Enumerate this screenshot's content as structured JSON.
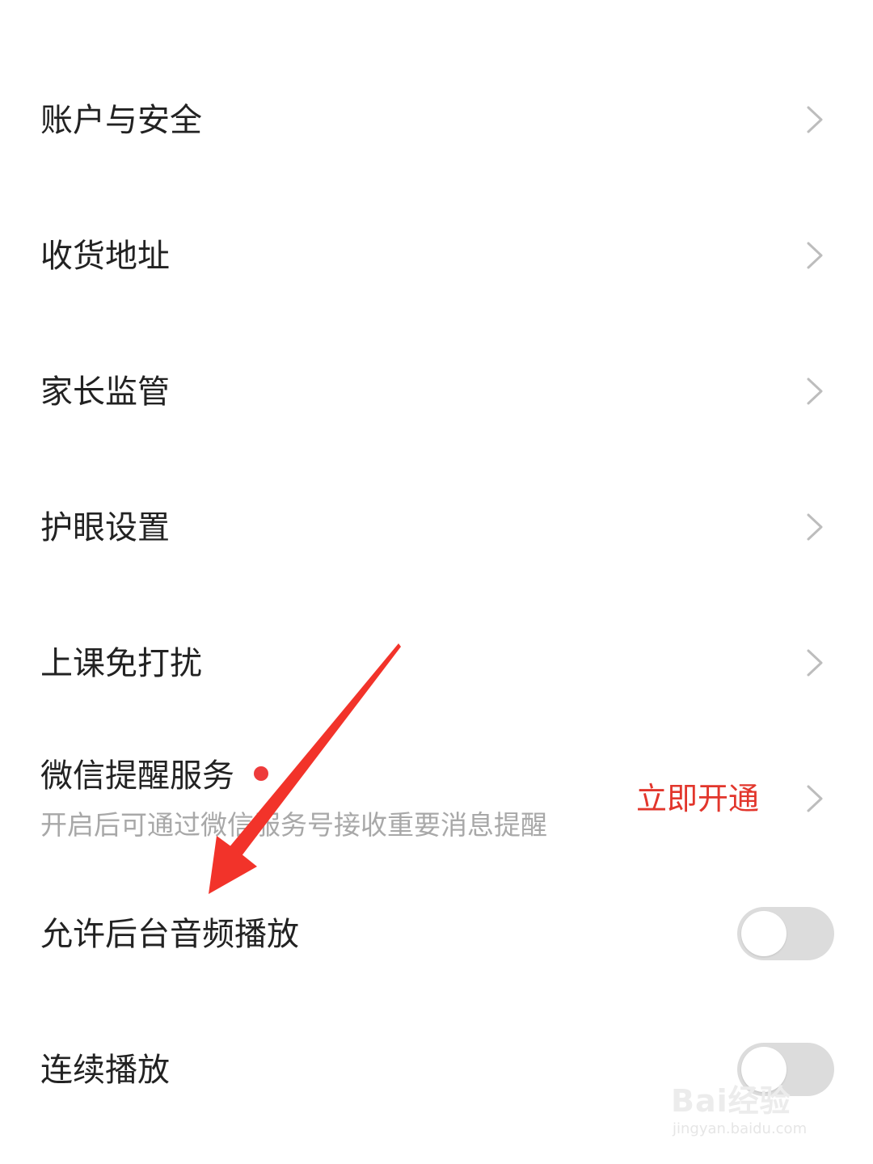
{
  "settings": {
    "items": [
      {
        "label": "账户与安全",
        "type": "link"
      },
      {
        "label": "收货地址",
        "type": "link"
      },
      {
        "label": "家长监管",
        "type": "link"
      },
      {
        "label": "护眼设置",
        "type": "link"
      },
      {
        "label": "上课免打扰",
        "type": "link"
      },
      {
        "label": "微信提醒服务",
        "type": "link",
        "sublabel": "开启后可通过微信服务号接收重要消息提醒",
        "action": "立即开通",
        "has_red_dot": true
      },
      {
        "label": "允许后台音频播放",
        "type": "toggle",
        "enabled": false
      },
      {
        "label": "连续播放",
        "type": "toggle",
        "enabled": false
      }
    ]
  },
  "annotation": {
    "arrow_color": "#f2332a",
    "points_to": "允许后台音频播放"
  },
  "watermark": {
    "text": "Bai经验",
    "url": "jingyan.baidu.com"
  },
  "colors": {
    "label": "#222222",
    "sublabel": "#a8a8a8",
    "accent_red": "#e2362c",
    "chevron": "#bdbdbd",
    "toggle_off": "#dcdcdc"
  },
  "icons": {
    "chevron": "chevron-right-icon",
    "notification": "red-dot-icon"
  }
}
